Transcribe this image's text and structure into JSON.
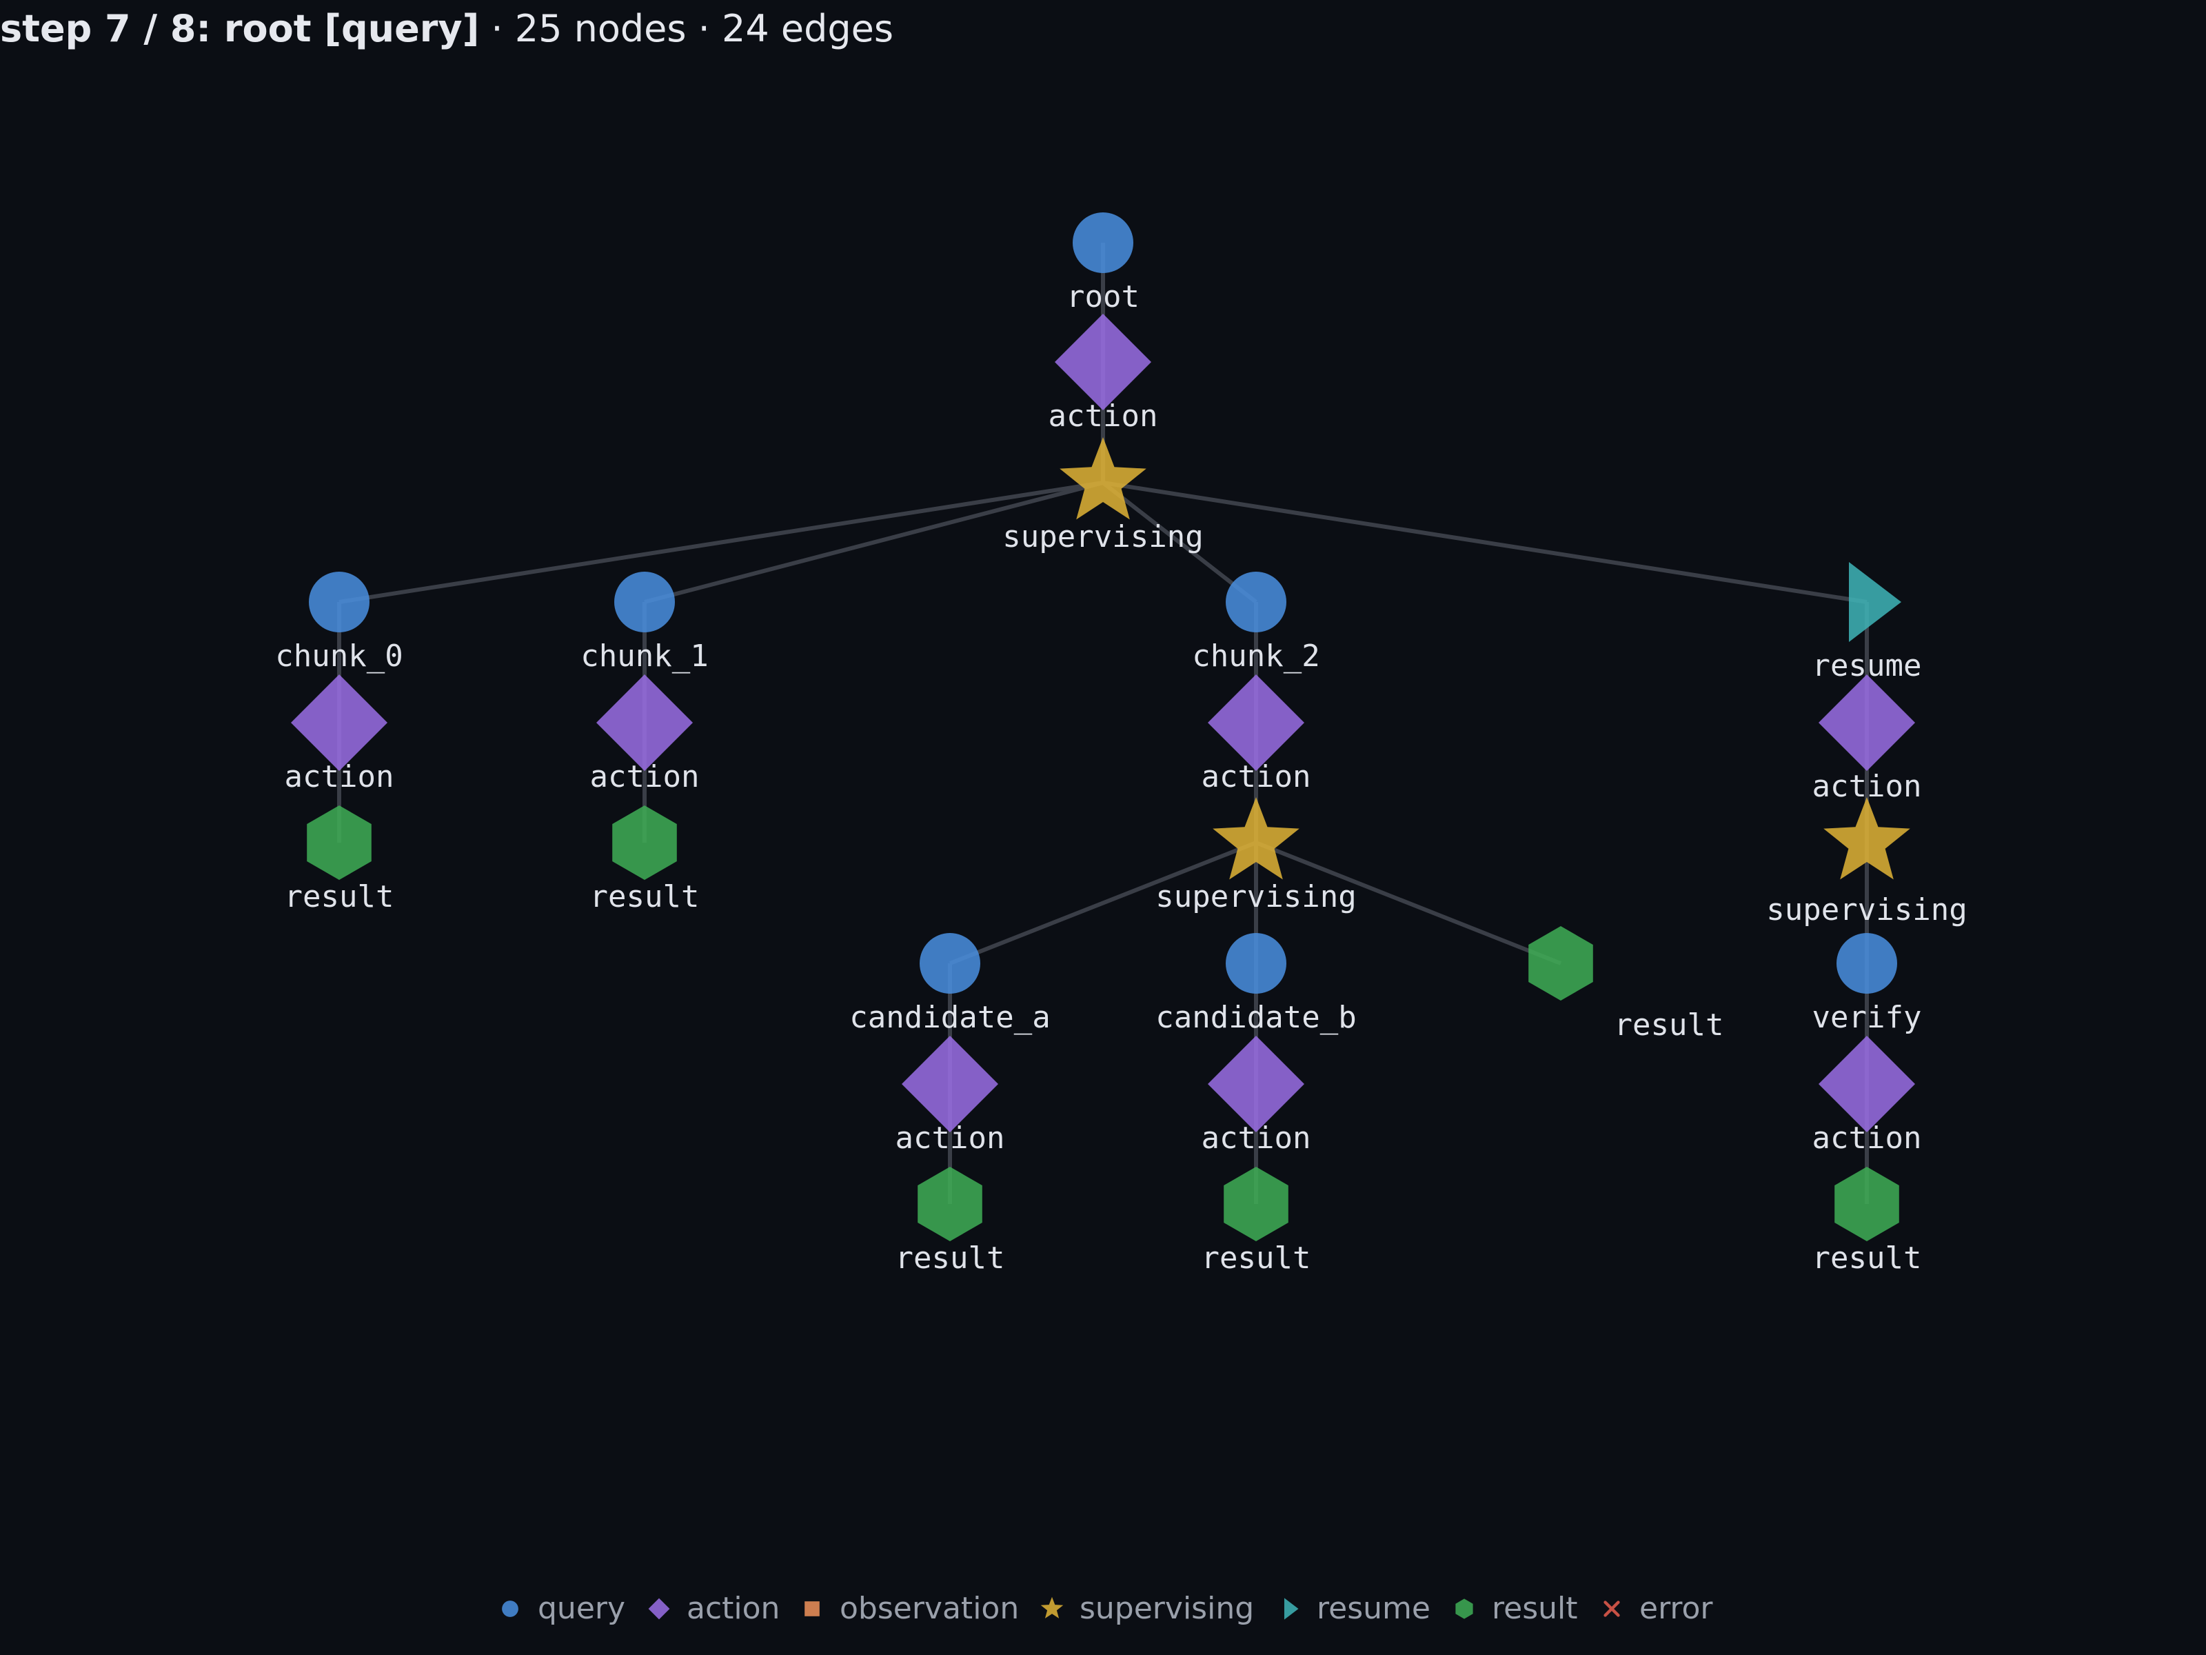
{
  "header": {
    "step": "step 7 / 8: root [query]",
    "stats": " · 25 nodes · 24 edges"
  },
  "colors": {
    "background": "#0b0e14",
    "edge": "#3a3e47",
    "query": "#4a8fe0",
    "action": "#9b6ee6",
    "observation": "#f0925a",
    "supervising": "#e2b436",
    "resume": "#3fb5b8",
    "result": "#3fae56",
    "error": "#e85d4e"
  },
  "nodes": [
    {
      "id": "root",
      "type": "query",
      "label": "root"
    },
    {
      "id": "action_root",
      "type": "action",
      "label": "action"
    },
    {
      "id": "sup_root",
      "type": "supervising",
      "label": "supervising"
    },
    {
      "id": "chunk_0",
      "type": "query",
      "label": "chunk_0"
    },
    {
      "id": "action_c0",
      "type": "action",
      "label": "action"
    },
    {
      "id": "result_c0",
      "type": "result",
      "label": "result"
    },
    {
      "id": "chunk_1",
      "type": "query",
      "label": "chunk_1"
    },
    {
      "id": "action_c1",
      "type": "action",
      "label": "action"
    },
    {
      "id": "result_c1",
      "type": "result",
      "label": "result"
    },
    {
      "id": "chunk_2",
      "type": "query",
      "label": "chunk_2"
    },
    {
      "id": "action_c2",
      "type": "action",
      "label": "action"
    },
    {
      "id": "sup_c2",
      "type": "supervising",
      "label": "supervising"
    },
    {
      "id": "candidate_a",
      "type": "query",
      "label": "candidate_a"
    },
    {
      "id": "action_ca",
      "type": "action",
      "label": "action"
    },
    {
      "id": "result_ca",
      "type": "result",
      "label": "result"
    },
    {
      "id": "candidate_b",
      "type": "query",
      "label": "candidate_b"
    },
    {
      "id": "action_cb",
      "type": "action",
      "label": "action"
    },
    {
      "id": "result_cb",
      "type": "result",
      "label": "result"
    },
    {
      "id": "result_sup2",
      "type": "result",
      "label": "result"
    },
    {
      "id": "resume",
      "type": "resume",
      "label": "resume"
    },
    {
      "id": "action_res",
      "type": "action",
      "label": "action"
    },
    {
      "id": "sup_res",
      "type": "supervising",
      "label": "supervising"
    },
    {
      "id": "verify",
      "type": "query",
      "label": "verify"
    },
    {
      "id": "action_ver",
      "type": "action",
      "label": "action"
    },
    {
      "id": "result_ver",
      "type": "result",
      "label": "result"
    }
  ],
  "edges": [
    [
      "root",
      "action_root"
    ],
    [
      "action_root",
      "sup_root"
    ],
    [
      "sup_root",
      "chunk_0"
    ],
    [
      "sup_root",
      "chunk_1"
    ],
    [
      "sup_root",
      "chunk_2"
    ],
    [
      "sup_root",
      "resume"
    ],
    [
      "chunk_0",
      "action_c0"
    ],
    [
      "action_c0",
      "result_c0"
    ],
    [
      "chunk_1",
      "action_c1"
    ],
    [
      "action_c1",
      "result_c1"
    ],
    [
      "chunk_2",
      "action_c2"
    ],
    [
      "action_c2",
      "sup_c2"
    ],
    [
      "sup_c2",
      "candidate_a"
    ],
    [
      "sup_c2",
      "candidate_b"
    ],
    [
      "sup_c2",
      "result_sup2"
    ],
    [
      "candidate_a",
      "action_ca"
    ],
    [
      "action_ca",
      "result_ca"
    ],
    [
      "candidate_b",
      "action_cb"
    ],
    [
      "action_cb",
      "result_cb"
    ],
    [
      "resume",
      "action_res"
    ],
    [
      "action_res",
      "sup_res"
    ],
    [
      "sup_res",
      "verify"
    ],
    [
      "verify",
      "action_ver"
    ],
    [
      "action_ver",
      "result_ver"
    ]
  ],
  "legend": [
    {
      "type": "query",
      "label": "query"
    },
    {
      "type": "action",
      "label": "action"
    },
    {
      "type": "observation",
      "label": "observation"
    },
    {
      "type": "supervising",
      "label": "supervising"
    },
    {
      "type": "resume",
      "label": "resume"
    },
    {
      "type": "result",
      "label": "result"
    },
    {
      "type": "error",
      "label": "error"
    }
  ]
}
